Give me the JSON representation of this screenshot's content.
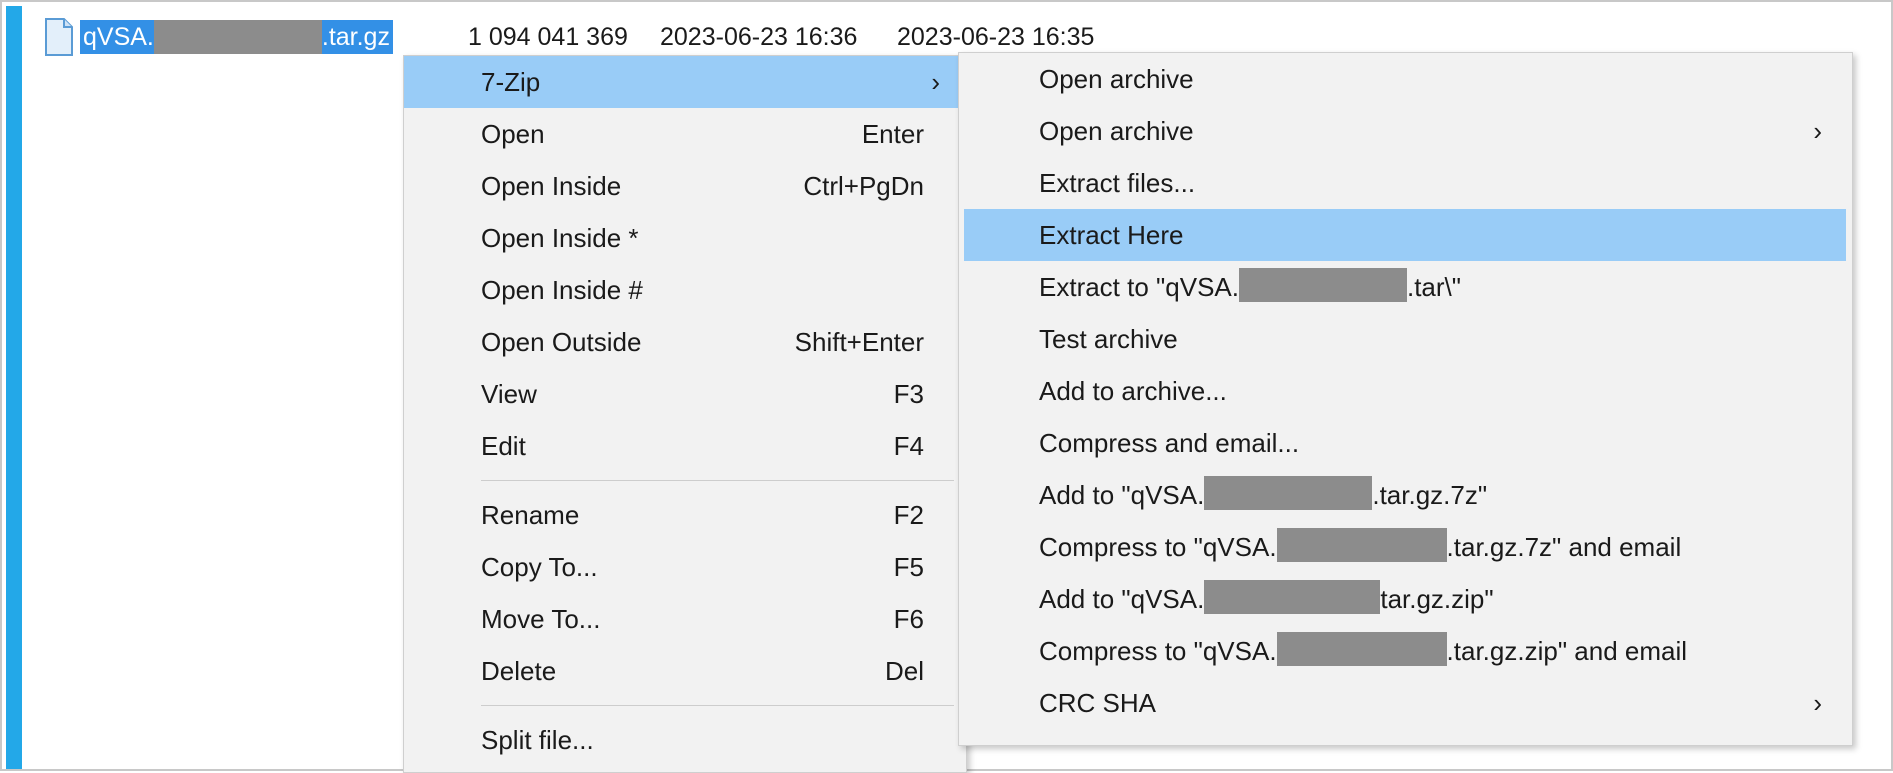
{
  "file": {
    "name_prefix": "qVSA.",
    "name_suffix": ".tar.gz",
    "size": "1 094 041 369",
    "modified": "2023-06-23 16:36",
    "created": "2023-06-23 16:35"
  },
  "main_menu": {
    "items": [
      {
        "label": "7-Zip",
        "shortcut": "",
        "arrow": "›"
      },
      {
        "label": "Open",
        "shortcut": "Enter"
      },
      {
        "label": "Open Inside",
        "shortcut": "Ctrl+PgDn"
      },
      {
        "label": "Open Inside *",
        "shortcut": ""
      },
      {
        "label": "Open Inside #",
        "shortcut": ""
      },
      {
        "label": "Open Outside",
        "shortcut": "Shift+Enter"
      },
      {
        "label": "View",
        "shortcut": "F3"
      },
      {
        "label": "Edit",
        "shortcut": "F4"
      },
      {
        "label": "Rename",
        "shortcut": "F2"
      },
      {
        "label": "Copy To...",
        "shortcut": "F5"
      },
      {
        "label": "Move To...",
        "shortcut": "F6"
      },
      {
        "label": "Delete",
        "shortcut": "Del"
      },
      {
        "label": "Split file...",
        "shortcut": ""
      }
    ]
  },
  "sub_menu": {
    "items": [
      {
        "label": "Open archive"
      },
      {
        "label": "Open archive",
        "arrow": "›"
      },
      {
        "label": "Extract files..."
      },
      {
        "label": "Extract Here"
      },
      {
        "prefix": "Extract to \"qVSA.",
        "suffix": ".tar\\\""
      },
      {
        "label": "Test archive"
      },
      {
        "label": "Add to archive..."
      },
      {
        "label": "Compress and email..."
      },
      {
        "prefix": "Add to \"qVSA.",
        "suffix": ".tar.gz.7z\""
      },
      {
        "prefix": "Compress to \"qVSA.",
        "suffix": ".tar.gz.7z\" and email"
      },
      {
        "prefix": "Add to \"qVSA.",
        "suffix": "tar.gz.zip\""
      },
      {
        "prefix": "Compress to \"qVSA.",
        "suffix": ".tar.gz.zip\" and email"
      },
      {
        "label": "CRC SHA",
        "arrow": "›"
      }
    ]
  },
  "colors": {
    "selection": "#3390e6",
    "highlight": "#99ccf7",
    "accent": "#23a8e8",
    "redaction": "#8c8c8c"
  },
  "icons": {
    "file": "document-file-icon",
    "submenu": "chevron-right-icon"
  }
}
